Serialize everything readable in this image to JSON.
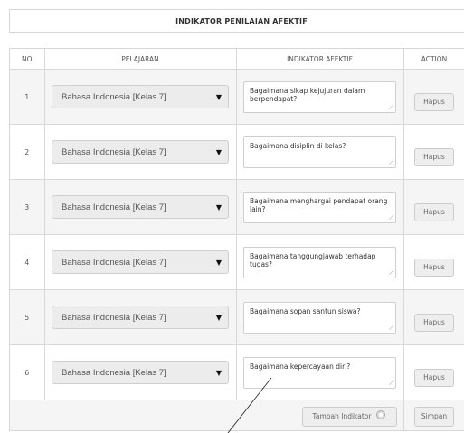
{
  "header": {
    "title": "INDIKATOR PENILAIAN AFEKTIF"
  },
  "table": {
    "columns": {
      "no": "NO",
      "pelajaran": "PELAJARAN",
      "indikator": "INDIKATOR AFEKTIF",
      "action": "ACTION"
    },
    "rows": [
      {
        "no": "1",
        "pelajaran": "Bahasa Indonesia [Kelas 7]",
        "indikator": "Bagaimana sikap kejujuran dalam berpendapat?",
        "action": "Hapus"
      },
      {
        "no": "2",
        "pelajaran": "Bahasa Indonesia [Kelas 7]",
        "indikator": "Bagaimana disiplin di kelas?",
        "action": "Hapus"
      },
      {
        "no": "3",
        "pelajaran": "Bahasa Indonesia [Kelas 7]",
        "indikator": "Bagaimana menghargai pendapat orang lain?",
        "action": "Hapus"
      },
      {
        "no": "4",
        "pelajaran": "Bahasa Indonesia [Kelas 7]",
        "indikator": "Bagaimana tanggungjawab terhadap tugas?",
        "action": "Hapus"
      },
      {
        "no": "5",
        "pelajaran": "Bahasa Indonesia [Kelas 7]",
        "indikator": "Bagaimana sopan santun siswa?",
        "action": "Hapus"
      },
      {
        "no": "6",
        "pelajaran": "Bahasa Indonesia [Kelas 7]",
        "indikator": "Bagaimana kepercayaan diri?",
        "action": "Hapus"
      }
    ]
  },
  "footer": {
    "tambah_label": "Tambah Indikator",
    "simpan_label": "Simpan"
  },
  "icons": {
    "select_arrow": "triangle-down-icon",
    "tambah": "plus-circle-icon",
    "resize": "resize-grip-icon"
  }
}
